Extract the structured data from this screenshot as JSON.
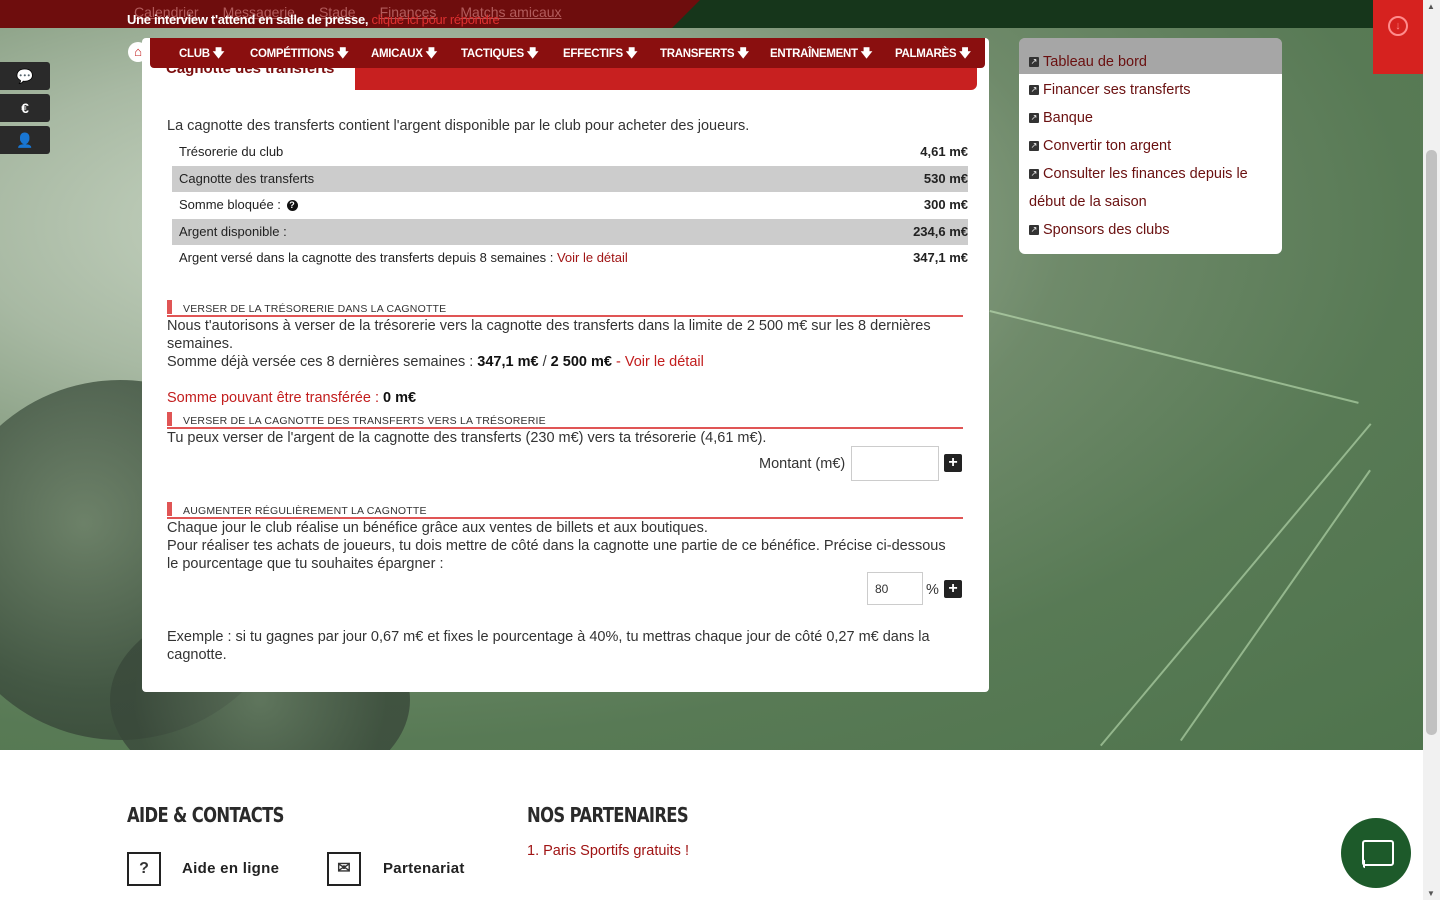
{
  "topbar": {
    "links": [
      "Calendrier",
      "Messagerie",
      "Stade",
      "Finances",
      "Matchs amicaux"
    ],
    "announcement": "Une interview t'attend en salle de presse,",
    "announcement_link": "clique ici pour répondre"
  },
  "nav": {
    "home_icon": "home-icon",
    "items": [
      {
        "label": "CLUB 🡇"
      },
      {
        "label": "COMPÉTITIONS 🡇"
      },
      {
        "label": "AMICAUX 🡇"
      },
      {
        "label": "TACTIQUES 🡇"
      },
      {
        "label": "EFFECTIFS 🡇"
      },
      {
        "label": "TRANSFERTS 🡇"
      },
      {
        "label": "ENTRAÎNEMENT 🡇"
      },
      {
        "label": "PALMARÈS 🡇"
      }
    ]
  },
  "side_buttons": [
    {
      "icon": "chat-icon",
      "glyph": "💬"
    },
    {
      "icon": "euro-icon",
      "glyph": "€"
    },
    {
      "icon": "user-icon",
      "glyph": "👤"
    }
  ],
  "main": {
    "tab_title": "Cagnotte des transferts",
    "intro": "La cagnotte des transferts contient l'argent disponible par le club pour acheter des joueurs.",
    "rows": [
      {
        "label": "Trésorerie du club",
        "value": "4,61 m€"
      },
      {
        "label": "Cagnotte des transferts",
        "value": "530 m€"
      },
      {
        "label": "Somme bloquée :",
        "value": "300 m€"
      },
      {
        "label": "Argent disponible :",
        "value": "234,6 m€"
      },
      {
        "label": "Argent versé dans la cagnotte des transferts depuis 8 semaines :",
        "link": "Voir le détail",
        "value": "347,1 m€"
      }
    ],
    "section1": {
      "title": "VERSER DE LA TRÉSORERIE DANS LA CAGNOTTE",
      "text1": "Nous t'autorisons à verser de la trésorerie vers la cagnotte des transferts dans la limite de 2 500 m€ sur les 8 dernières semaines.",
      "text2_prefix": "Somme déjà versée ces 8 dernières semaines :",
      "text2_amount": "347,1 m€",
      "text2_sep": "/",
      "text2_limit": "2 500 m€",
      "text2_link": "- Voir le détail",
      "transferable_label": "Somme pouvant être transférée :",
      "transferable_value": "0 m€"
    },
    "section2": {
      "title": "VERSER DE LA CAGNOTTE DES TRANSFERTS VERS LA TRÉSORERIE",
      "text": "Tu peux verser de l'argent de la cagnotte des transferts (230 m€) vers ta trésorerie (4,61 m€).",
      "amount_label": "Montant (m€)",
      "amount_value": ""
    },
    "section3": {
      "title": "AUGMENTER RÉGULIÈREMENT LA CAGNOTTE",
      "text1": "Chaque jour le club réalise un bénéfice grâce aux ventes de billets et aux boutiques.",
      "text2": "Pour réaliser tes achats de joueurs, tu dois mettre de côté dans la cagnotte une partie de ce bénéfice. Précise ci-dessous le pourcentage que tu souhaites épargner :",
      "percent_value": "80",
      "percent_sign": "%",
      "example": "Exemple : si tu gagnes par jour 0,67 m€ et fixes le pourcentage à 40%, tu mettras chaque jour de côté 0,27 m€ dans la cagnotte."
    }
  },
  "right_panel": {
    "links": [
      "Tableau de bord",
      "Financer ses transferts",
      "Banque",
      "Convertir ton argent",
      "Consulter les finances depuis le début de la saison",
      "Sponsors des clubs"
    ]
  },
  "footer": {
    "help_title": "AIDE & CONTACTS",
    "help_items": [
      {
        "icon": "question-icon",
        "glyph": "?",
        "label": "Aide en ligne"
      },
      {
        "icon": "envelope-icon",
        "glyph": "✉",
        "label": "Partenariat"
      }
    ],
    "partners_title": "NOS PARTENAIRES",
    "partners": [
      "1. Paris Sportifs gratuits !"
    ]
  },
  "colors": {
    "brand_red": "#c21d1d",
    "dark_red": "#8a0f0f",
    "chat_green": "#1d5a2a"
  }
}
